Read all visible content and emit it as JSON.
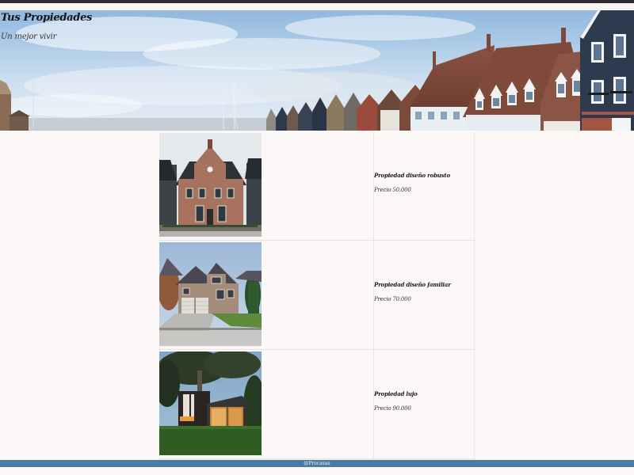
{
  "header": {
    "title": "Tus Propiedades",
    "subtitle": "Un mejor vivir"
  },
  "properties": [
    {
      "name": "Propiedad diseño robusto",
      "price": "Precio 50.000",
      "image": "brick-house-photo"
    },
    {
      "name": "Propiedad diseño familiar",
      "price": "Precio 70.000",
      "image": "family-house-photo"
    },
    {
      "name": "Propiedad lujo",
      "price": "Precio 90.000",
      "image": "luxury-house-photo"
    }
  ],
  "footer": {
    "text": "@Procasas",
    "color": "#4a7aa6"
  },
  "colors": {
    "page_background": "#fdf8f8",
    "sky": "#9ec3e6"
  }
}
